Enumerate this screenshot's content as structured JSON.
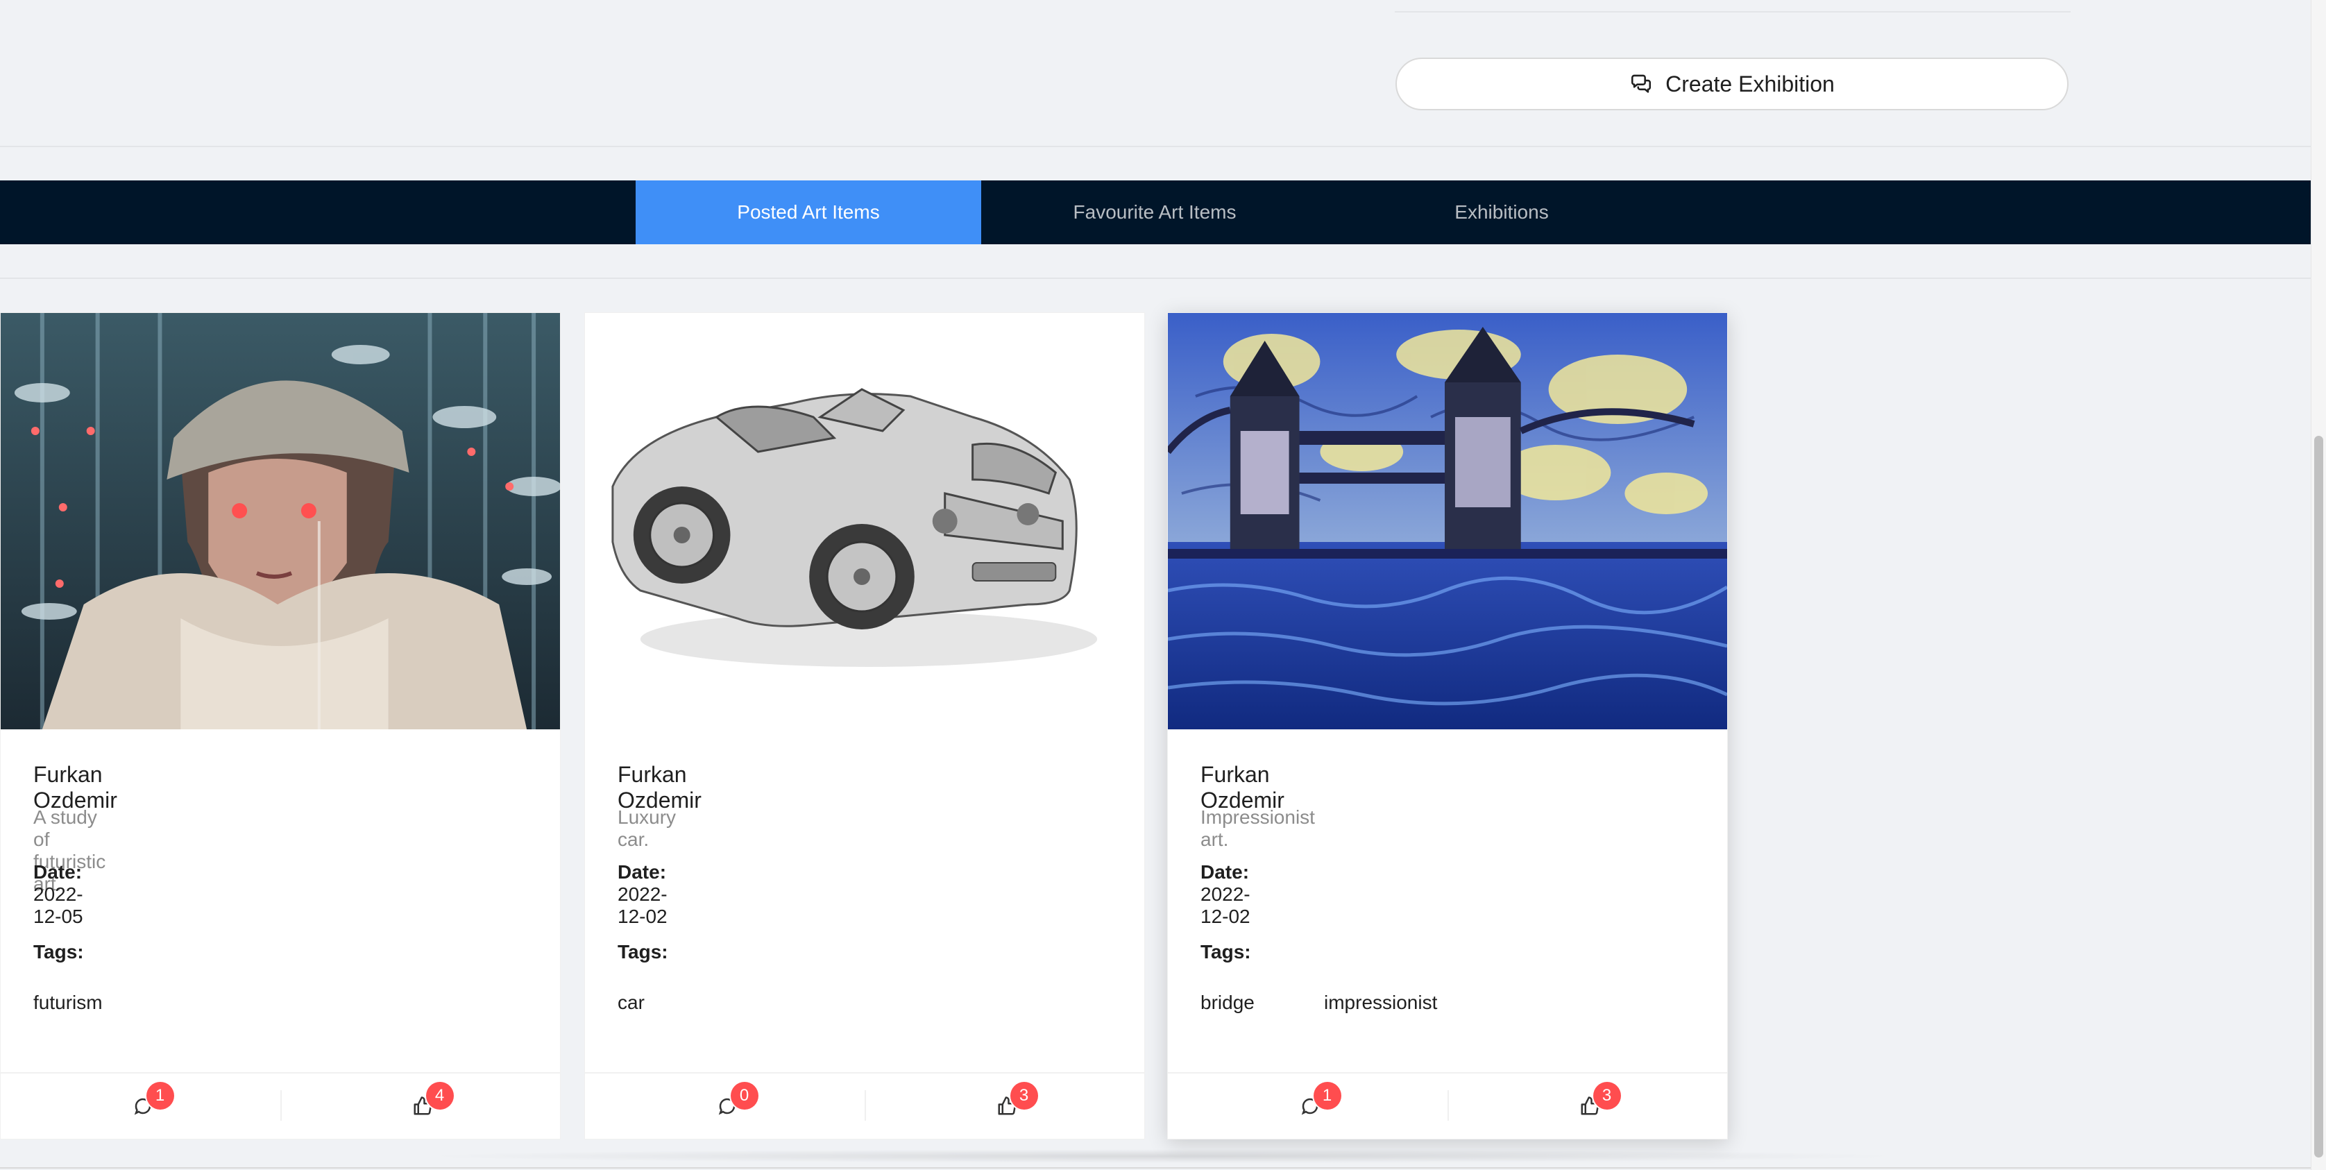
{
  "header": {
    "create_exhibition_label": "Create Exhibition",
    "create_exhibition_icon": "comments-icon"
  },
  "tabs": [
    {
      "label": "Posted Art Items",
      "active": true
    },
    {
      "label": "Favourite Art Items",
      "active": false
    },
    {
      "label": "Exhibitions",
      "active": false
    }
  ],
  "cards": [
    {
      "author": "Furkan Ozdemir",
      "description": "A study of futuristic art.",
      "date_label": "Date:",
      "date": "2022-12-05",
      "tags_label": "Tags:",
      "tags": [
        "futurism"
      ],
      "comment_count": "1",
      "like_count": "4"
    },
    {
      "author": "Furkan Ozdemir",
      "description": "Luxury car.",
      "date_label": "Date:",
      "date": "2022-12-02",
      "tags_label": "Tags:",
      "tags": [
        "car"
      ],
      "comment_count": "0",
      "like_count": "3"
    },
    {
      "author": "Furkan Ozdemir",
      "description": "Impressionist art.",
      "date_label": "Date:",
      "date": "2022-12-02",
      "tags_label": "Tags:",
      "tags": [
        "bridge",
        "impressionist"
      ],
      "comment_count": "1",
      "like_count": "3"
    }
  ],
  "colors": {
    "active_tab": "#3f8ff7",
    "navbar": "#001529",
    "badge": "#ff4d4f",
    "background": "#f0f2f5"
  }
}
